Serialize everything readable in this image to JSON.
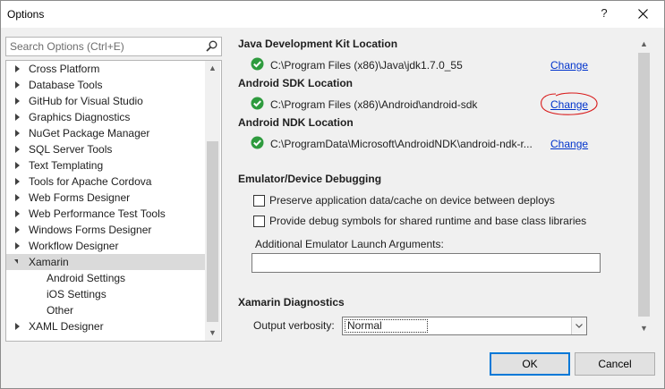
{
  "window": {
    "title": "Options",
    "help_label": "?"
  },
  "search": {
    "placeholder": "Search Options (Ctrl+E)"
  },
  "tree": {
    "items": [
      {
        "label": "Cross Platform",
        "expanded": false
      },
      {
        "label": "Database Tools",
        "expanded": false
      },
      {
        "label": "GitHub for Visual Studio",
        "expanded": false
      },
      {
        "label": "Graphics Diagnostics",
        "expanded": false
      },
      {
        "label": "NuGet Package Manager",
        "expanded": false
      },
      {
        "label": "SQL Server Tools",
        "expanded": false
      },
      {
        "label": "Text Templating",
        "expanded": false
      },
      {
        "label": "Tools for Apache Cordova",
        "expanded": false
      },
      {
        "label": "Web Forms Designer",
        "expanded": false
      },
      {
        "label": "Web Performance Test Tools",
        "expanded": false
      },
      {
        "label": "Windows Forms Designer",
        "expanded": false
      },
      {
        "label": "Workflow Designer",
        "expanded": false
      },
      {
        "label": "Xamarin",
        "expanded": true,
        "selected": true
      },
      {
        "label": "Android Settings",
        "child": true
      },
      {
        "label": "iOS Settings",
        "child": true
      },
      {
        "label": "Other",
        "child": true
      },
      {
        "label": "XAML Designer",
        "expanded": false
      }
    ]
  },
  "jdk": {
    "heading": "Java Development Kit Location",
    "path": "C:\\Program Files (x86)\\Java\\jdk1.7.0_55",
    "change_label": "Change"
  },
  "sdk": {
    "heading": "Android SDK Location",
    "path": "C:\\Program Files (x86)\\Android\\android-sdk",
    "change_label": "Change"
  },
  "ndk": {
    "heading": "Android NDK Location",
    "path": "C:\\ProgramData\\Microsoft\\AndroidNDK\\android-ndk-r...",
    "change_label": "Change"
  },
  "emulator": {
    "heading": "Emulator/Device Debugging",
    "preserve_label": "Preserve application data/cache on device between deploys",
    "preserve_checked": false,
    "debug_symbols_label": "Provide debug symbols for shared runtime and base class libraries",
    "debug_symbols_checked": false,
    "args_label": "Additional Emulator Launch Arguments:",
    "args_value": ""
  },
  "diagnostics": {
    "heading": "Xamarin Diagnostics",
    "verbosity_label": "Output verbosity:",
    "verbosity_value": "Normal"
  },
  "buttons": {
    "ok": "OK",
    "cancel": "Cancel"
  },
  "colors": {
    "link": "#0033cc",
    "check_green": "#2e9b3e",
    "annotation_red": "#d81b1b",
    "focus_blue": "#0078d7"
  }
}
